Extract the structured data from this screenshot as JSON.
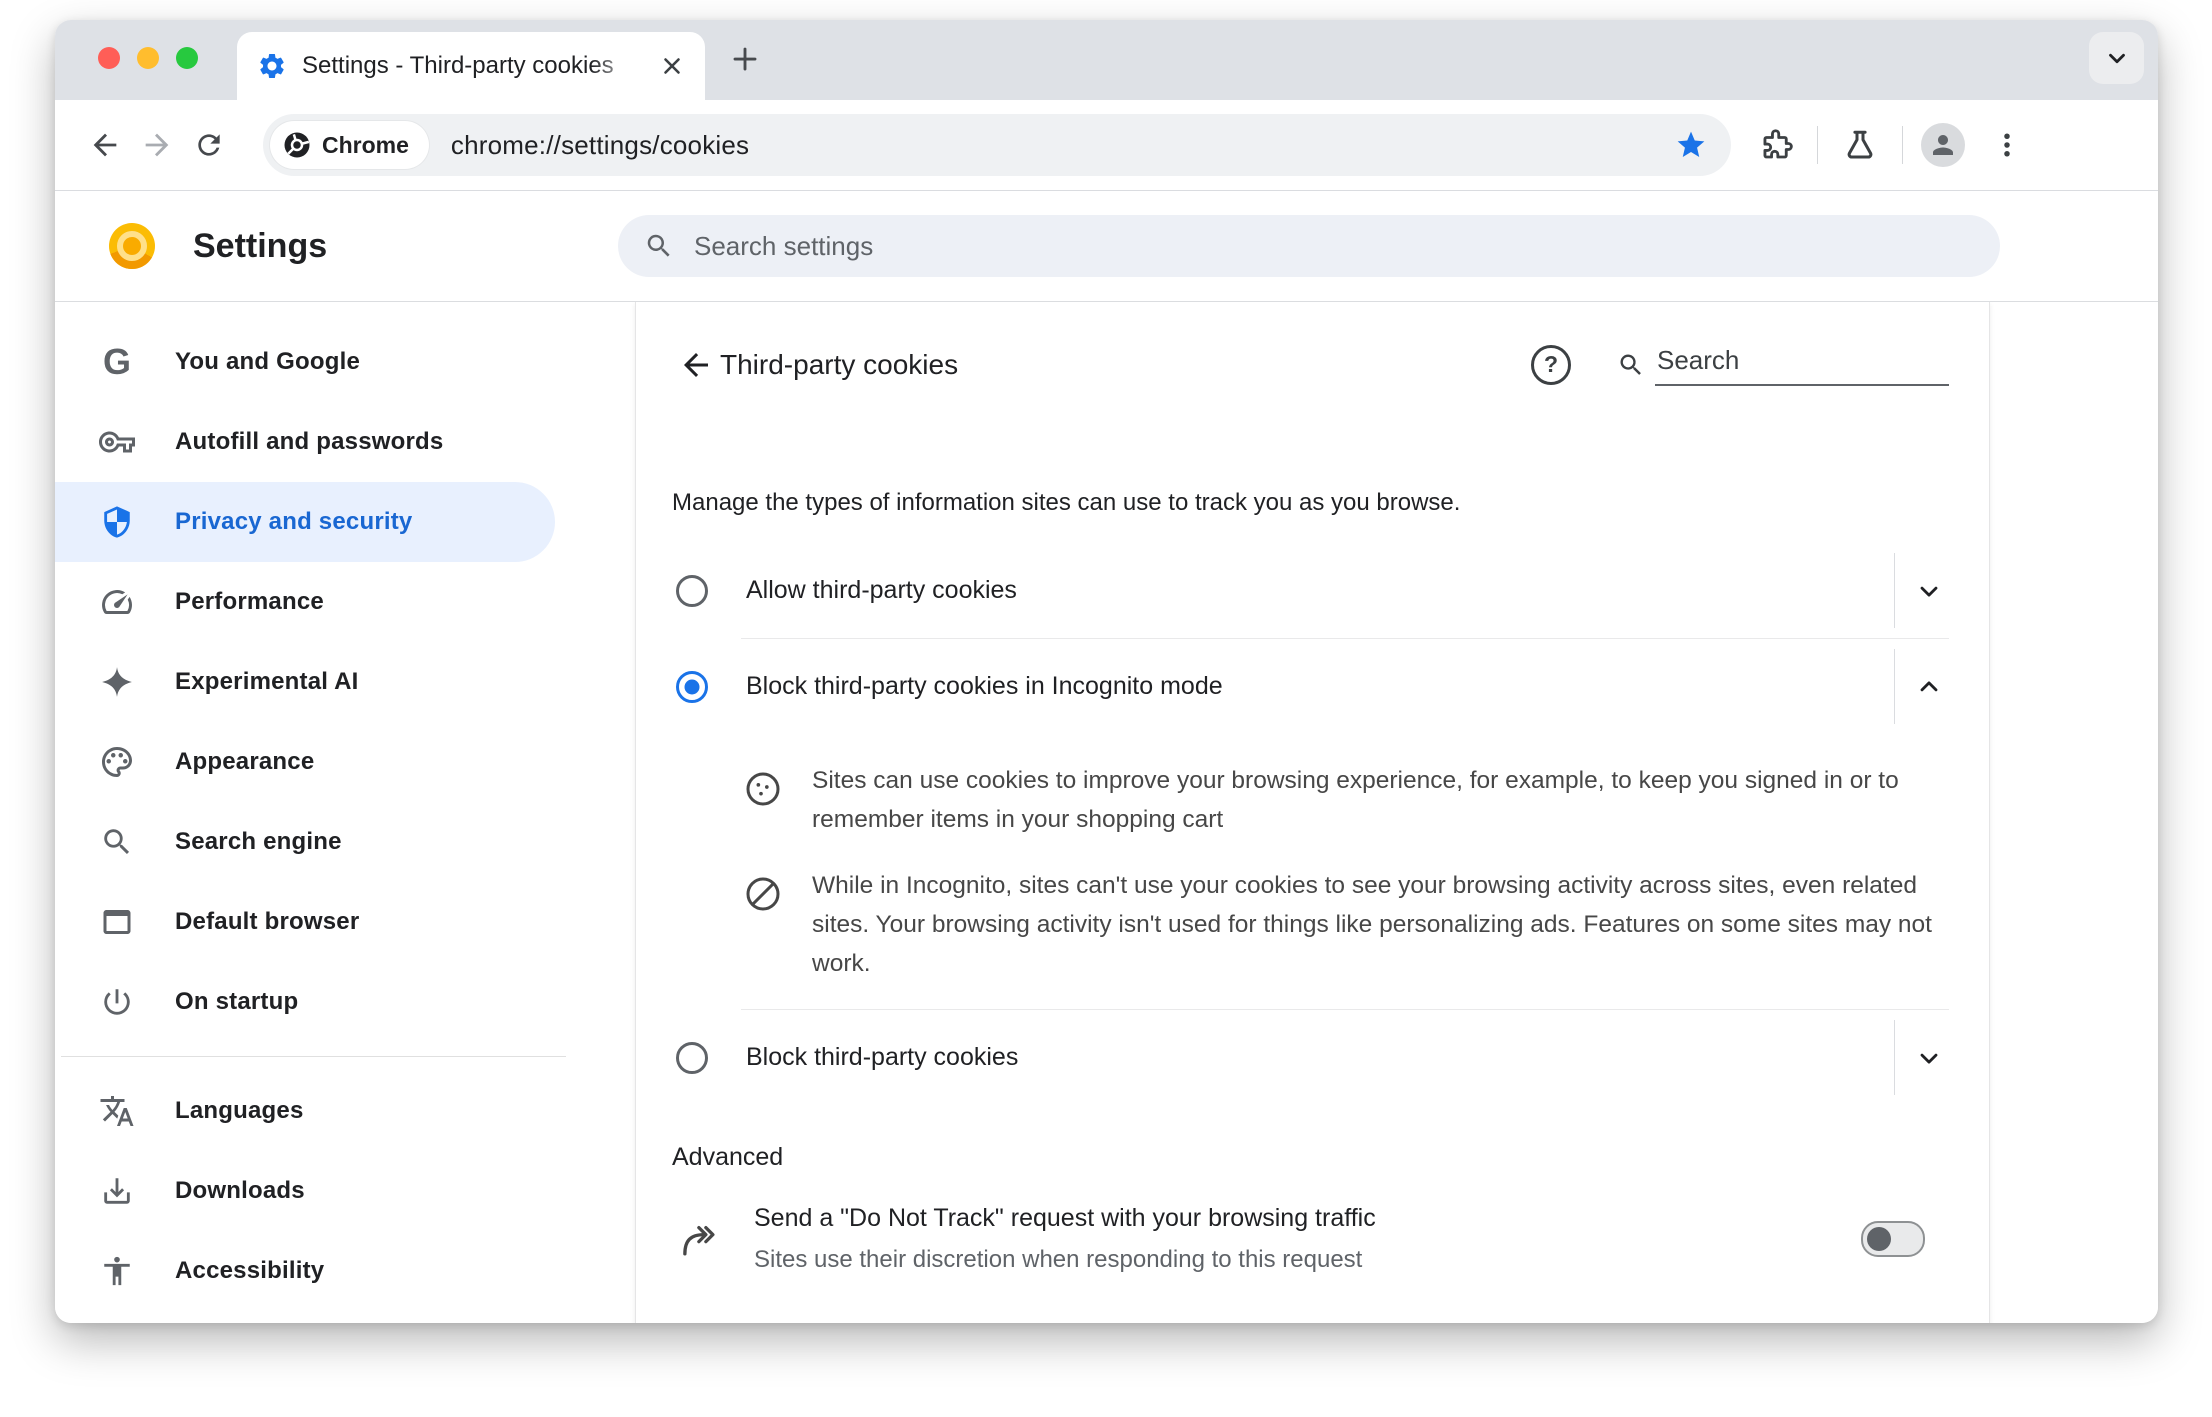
{
  "browser": {
    "tab_title": "Settings - Third-party cookies",
    "url_chip": "Chrome",
    "url": "chrome://settings/cookies"
  },
  "settings_header": {
    "title": "Settings",
    "search_placeholder": "Search settings"
  },
  "sidebar": {
    "items": [
      {
        "label": "You and Google",
        "icon": "google-g-icon",
        "selected": false
      },
      {
        "label": "Autofill and passwords",
        "icon": "key-icon",
        "selected": false
      },
      {
        "label": "Privacy and security",
        "icon": "shield-icon",
        "selected": true
      },
      {
        "label": "Performance",
        "icon": "speedometer-icon",
        "selected": false
      },
      {
        "label": "Experimental AI",
        "icon": "sparkle-icon",
        "selected": false
      },
      {
        "label": "Appearance",
        "icon": "palette-icon",
        "selected": false
      },
      {
        "label": "Search engine",
        "icon": "search-icon",
        "selected": false
      },
      {
        "label": "Default browser",
        "icon": "browser-window-icon",
        "selected": false
      },
      {
        "label": "On startup",
        "icon": "power-icon",
        "selected": false
      },
      {
        "label": "Languages",
        "icon": "translate-icon",
        "selected": false
      },
      {
        "label": "Downloads",
        "icon": "download-icon",
        "selected": false
      },
      {
        "label": "Accessibility",
        "icon": "accessibility-icon",
        "selected": false
      }
    ]
  },
  "page": {
    "title": "Third-party cookies",
    "search_placeholder": "Search",
    "intro": "Manage the types of information sites can use to track you as you browse.",
    "options": [
      {
        "label": "Allow third-party cookies",
        "selected": false,
        "expanded": false
      },
      {
        "label": "Block third-party cookies in Incognito mode",
        "selected": true,
        "expanded": true,
        "details": [
          {
            "icon": "cookie-icon",
            "text": "Sites can use cookies to improve your browsing experience, for example, to keep you signed in or to remember items in your shopping cart"
          },
          {
            "icon": "blocked-icon",
            "text": "While in Incognito, sites can't use your cookies to see your browsing activity across sites, even related sites. Your browsing activity isn't used for things like personalizing ads. Features on some sites may not work."
          }
        ]
      },
      {
        "label": "Block third-party cookies",
        "selected": false,
        "expanded": false
      }
    ],
    "advanced_label": "Advanced",
    "do_not_track": {
      "title": "Send a \"Do Not Track\" request with your browsing traffic",
      "subtitle": "Sites use their discretion when responding to this request",
      "enabled": false
    }
  },
  "colors": {
    "accent_blue": "#1A73E8",
    "selected_sidebar_bg": "#E8F0FE",
    "selected_sidebar_text": "#1967D2",
    "tab_strip_bg": "#DEE1E6",
    "omnibox_bg": "#EFF1F3",
    "settings_search_bg": "#EDF0F6",
    "traffic_red": "#FF5E57",
    "traffic_yellow": "#FFBD2E",
    "traffic_green": "#27C93F",
    "toggle_off_knob": "#5F6368"
  }
}
